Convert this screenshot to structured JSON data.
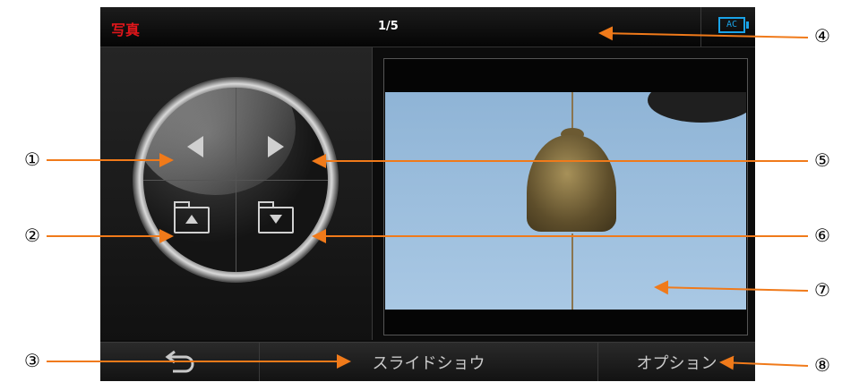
{
  "header": {
    "title": "写真",
    "counter": "1/5",
    "battery_label": "AC"
  },
  "controls": {
    "prev_icon": "triangle-left-icon",
    "next_icon": "triangle-right-icon",
    "folder_up_icon": "folder-up-icon",
    "folder_down_icon": "folder-down-icon"
  },
  "bottom_bar": {
    "back_icon": "return-arrow-icon",
    "slideshow_label": "スライドショウ",
    "options_label": "オプション"
  },
  "callouts": [
    "①",
    "②",
    "③",
    "④",
    "⑤",
    "⑥",
    "⑦",
    "⑧"
  ],
  "colors": {
    "accent_red": "#e0161b",
    "battery_blue": "#1aa3e8",
    "annotation_orange": "#f07a1a"
  }
}
